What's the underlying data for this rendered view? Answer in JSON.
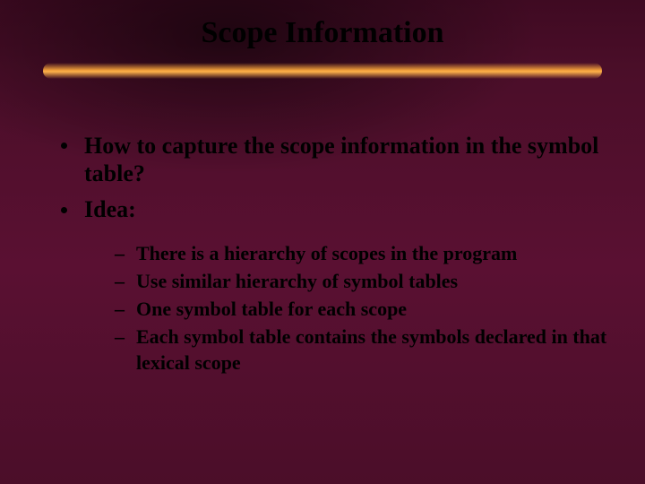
{
  "title": "Scope Information",
  "bullets_l1": [
    "How to capture the scope information in the symbol table?",
    "Idea:"
  ],
  "bullets_l2": [
    "There is a hierarchy of scopes in the program",
    "Use similar hierarchy of symbol tables",
    "One symbol table for each scope",
    "Each symbol table contains the symbols declared in that lexical scope"
  ]
}
